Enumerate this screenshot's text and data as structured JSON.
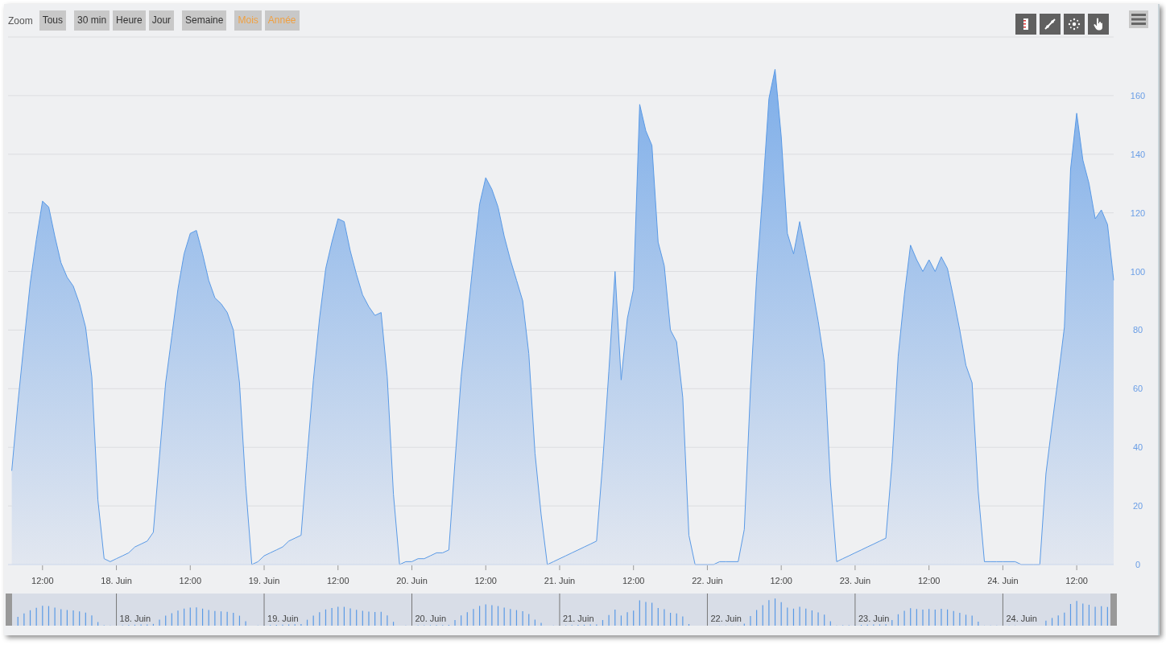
{
  "range_selector": {
    "label": "Zoom",
    "buttons": [
      {
        "label": "Tous",
        "disabled": false
      },
      {
        "label": "30 min",
        "disabled": false
      },
      {
        "label": "Heure",
        "disabled": false
      },
      {
        "label": "Jour",
        "disabled": false
      },
      {
        "label": "Semaine",
        "disabled": false
      },
      {
        "label": "Mois",
        "disabled": true
      },
      {
        "label": "Année",
        "disabled": true
      }
    ]
  },
  "toolbar": {
    "tools": [
      {
        "kind": "ruler"
      },
      {
        "kind": "line"
      },
      {
        "kind": "crosshair"
      },
      {
        "kind": "pan"
      }
    ]
  },
  "chart": {
    "chart_data": {
      "type": "area",
      "grid": true,
      "ylim": [
        0,
        180
      ],
      "yticks": [
        0,
        20,
        40,
        60,
        80,
        100,
        120,
        140,
        160
      ],
      "categories": [
        null,
        null,
        null,
        null,
        null,
        "12:00",
        null,
        null,
        null,
        null,
        null,
        null,
        null,
        null,
        null,
        null,
        null,
        "18. Juin",
        null,
        null,
        null,
        null,
        null,
        null,
        null,
        null,
        null,
        null,
        null,
        "12:00",
        null,
        null,
        null,
        null,
        null,
        null,
        null,
        null,
        null,
        null,
        null,
        "19. Juin",
        null,
        null,
        null,
        null,
        null,
        null,
        null,
        null,
        null,
        null,
        null,
        "12:00",
        null,
        null,
        null,
        null,
        null,
        null,
        null,
        null,
        null,
        null,
        null,
        "20. Juin",
        null,
        null,
        null,
        null,
        null,
        null,
        null,
        null,
        null,
        null,
        null,
        "12:00",
        null,
        null,
        null,
        null,
        null,
        null,
        null,
        null,
        null,
        null,
        null,
        "21. Juin",
        null,
        null,
        null,
        null,
        null,
        null,
        null,
        null,
        null,
        null,
        null,
        "12:00",
        null,
        null,
        null,
        null,
        null,
        null,
        null,
        null,
        null,
        null,
        null,
        "22. Juin",
        null,
        null,
        null,
        null,
        null,
        null,
        null,
        null,
        null,
        null,
        null,
        "12:00",
        null,
        null,
        null,
        null,
        null,
        null,
        null,
        null,
        null,
        null,
        null,
        "23. Juin",
        null,
        null,
        null,
        null,
        null,
        null,
        null,
        null,
        null,
        null,
        null,
        "12:00",
        null,
        null,
        null,
        null,
        null,
        null,
        null,
        null,
        null,
        null,
        null,
        "24. Juin",
        null,
        null,
        null,
        null,
        null,
        null,
        null,
        null,
        null,
        null,
        null,
        "12:00",
        null,
        null,
        null,
        null,
        null,
        null
      ],
      "values": [
        32,
        55,
        76,
        96,
        111,
        124,
        122,
        112,
        103,
        98,
        95,
        89,
        81,
        64,
        22,
        2,
        1,
        2,
        3,
        4,
        6,
        7,
        8,
        11,
        37,
        62,
        78,
        94,
        106,
        113,
        114,
        106,
        97,
        91,
        89,
        86,
        80,
        62,
        27,
        0,
        1,
        3,
        4,
        5,
        6,
        8,
        9,
        10,
        37,
        63,
        84,
        101,
        110,
        118,
        117,
        107,
        99,
        92,
        88,
        85,
        86,
        64,
        24,
        0,
        1,
        1,
        2,
        2,
        3,
        4,
        4,
        5,
        35,
        64,
        84,
        104,
        123,
        132,
        128,
        122,
        112,
        104,
        97,
        90,
        72,
        38,
        17,
        0,
        1,
        2,
        3,
        4,
        5,
        6,
        7,
        8,
        35,
        66,
        100,
        63,
        84,
        94,
        157,
        148,
        143,
        110,
        102,
        80,
        76,
        57,
        10,
        0,
        0,
        0,
        0,
        1,
        1,
        1,
        1,
        12,
        60,
        98,
        127,
        159,
        169,
        146,
        113,
        106,
        117,
        106,
        95,
        83,
        69,
        28,
        1,
        2,
        3,
        4,
        5,
        6,
        7,
        8,
        9,
        35,
        71,
        92,
        109,
        104,
        100,
        104,
        100,
        105,
        101,
        91,
        80,
        68,
        62,
        25,
        1,
        1,
        1,
        1,
        1,
        1,
        0,
        0,
        0,
        0,
        31,
        48,
        64,
        81,
        135,
        154,
        138,
        130,
        118,
        121,
        116,
        97
      ]
    }
  },
  "navigator": {
    "labels": [
      "18. Juin",
      "19. Juin",
      "20. Juin",
      "21. Juin",
      "22. Juin",
      "23. Juin",
      "24. Juin"
    ]
  }
}
